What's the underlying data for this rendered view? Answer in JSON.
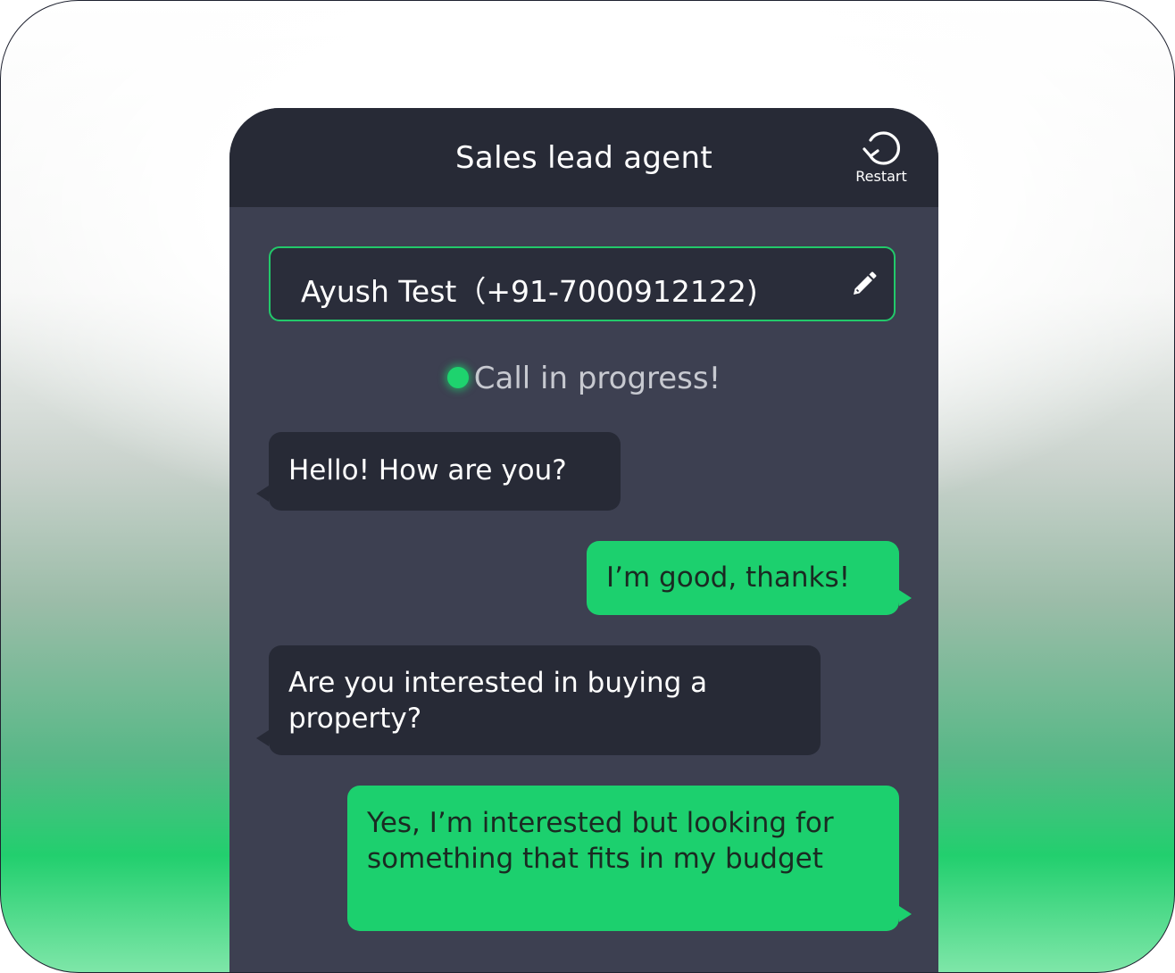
{
  "header": {
    "title": "Sales lead agent",
    "restart_label": "Restart",
    "restart_icon": "restart-icon"
  },
  "contact": {
    "text": "Ayush Test（+91-7000912122)",
    "edit_icon": "pencil-icon"
  },
  "status": {
    "text": "Call in progress!",
    "color": "#1ed36e"
  },
  "messages": [
    {
      "sender": "agent",
      "text": "Hello! How are you?"
    },
    {
      "sender": "user",
      "text": "I’m good, thanks!"
    },
    {
      "sender": "agent",
      "text": "Are you interested in buying a property?"
    },
    {
      "sender": "user",
      "text": "Yes, I’m interested but looking for something that fits in my budget"
    }
  ],
  "colors": {
    "accent": "#1cd06e",
    "header_bg": "#272a36",
    "panel_bg": "#3d4051"
  }
}
